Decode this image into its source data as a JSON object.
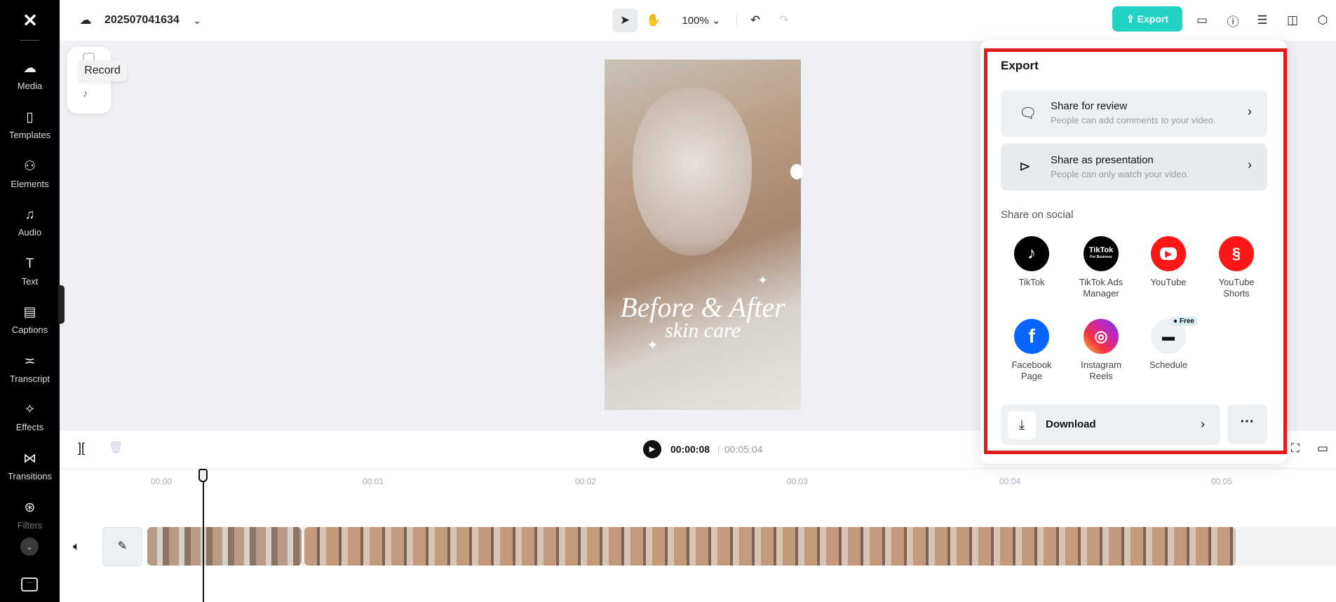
{
  "project": {
    "name": "202507041634"
  },
  "sidebar": {
    "items": [
      {
        "label": "Media",
        "icon": "cloud-upload-icon"
      },
      {
        "label": "Templates",
        "icon": "templates-icon"
      },
      {
        "label": "Elements",
        "icon": "elements-icon"
      },
      {
        "label": "Audio",
        "icon": "music-icon"
      },
      {
        "label": "Text",
        "icon": "text-icon"
      },
      {
        "label": "Captions",
        "icon": "captions-icon"
      },
      {
        "label": "Transcript",
        "icon": "transcript-icon"
      },
      {
        "label": "Effects",
        "icon": "effects-icon"
      },
      {
        "label": "Transitions",
        "icon": "transitions-icon"
      },
      {
        "label": "Filters",
        "icon": "filters-icon"
      }
    ]
  },
  "toolbar": {
    "zoom": "100%",
    "export_label": "Export",
    "accent": "#22d3c5"
  },
  "canvas": {
    "tooltip": "Record",
    "video_title": "Before & After",
    "video_subtitle": "skin care"
  },
  "export": {
    "title": "Export",
    "share_review": {
      "title": "Share for review",
      "subtitle": "People can add comments to your video."
    },
    "share_presentation": {
      "title": "Share as presentation",
      "subtitle": "People can only watch your video."
    },
    "social_heading": "Share on social",
    "social": [
      {
        "label": "TikTok"
      },
      {
        "label": "TikTok Ads Manager",
        "logo": "TikTok",
        "logo_sub": "For Business"
      },
      {
        "label": "YouTube"
      },
      {
        "label": "YouTube Shorts"
      },
      {
        "label": "Facebook Page"
      },
      {
        "label": "Instagram Reels"
      },
      {
        "label": "Schedule",
        "badge": "Free"
      }
    ],
    "download": "Download"
  },
  "timeline": {
    "current": "00:00:08",
    "total": "00:05:04",
    "ticks": [
      "00:00",
      "00:01",
      "00:02",
      "00:03",
      "00:04",
      "00:05"
    ]
  }
}
